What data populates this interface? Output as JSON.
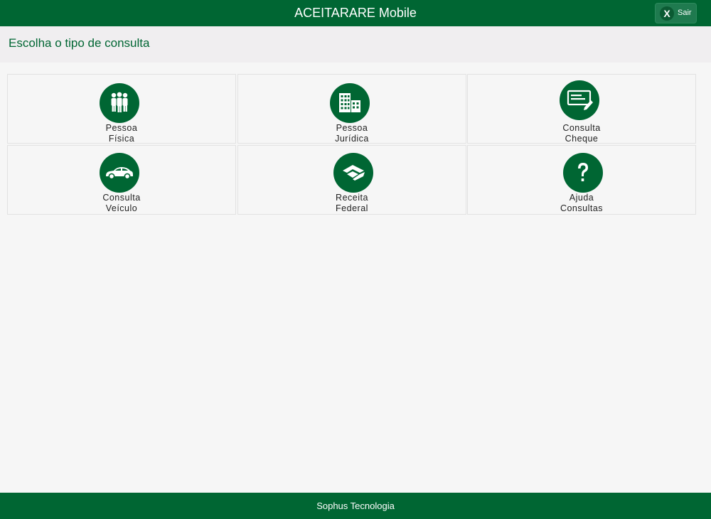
{
  "header": {
    "title": "ACEITARARE Mobile",
    "exit_button": {
      "icon": "close-icon",
      "icon_glyph": "X",
      "label": "Sair"
    }
  },
  "subheader": {
    "title": "Escolha o tipo de consulta"
  },
  "tiles": [
    {
      "icon": "people-icon",
      "line1": "Pessoa",
      "line2": "Física"
    },
    {
      "icon": "building-icon",
      "line1": "Pessoa",
      "line2": "Jurídica"
    },
    {
      "icon": "check-icon",
      "line1": "Consulta",
      "line2": "Cheque"
    },
    {
      "icon": "car-icon",
      "line1": "Consulta",
      "line2": "Veículo"
    },
    {
      "icon": "receita-federal-icon",
      "line1": "Receita",
      "line2": "Federal"
    },
    {
      "icon": "help-icon",
      "line1": "Ajuda",
      "line2": "Consultas"
    }
  ],
  "footer": {
    "text": "Sophus Tecnologia"
  },
  "colors": {
    "primary": "#006633",
    "background": "#f6f6f6",
    "subheader_bg": "#f0eef0"
  }
}
